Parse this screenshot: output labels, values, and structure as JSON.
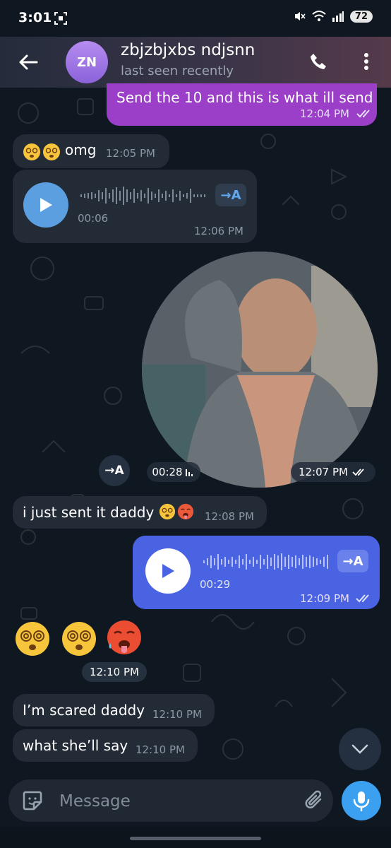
{
  "status_bar": {
    "time": "3:01",
    "battery": "72"
  },
  "header": {
    "avatar_initials": "ZN",
    "contact_name": "zbjzbjxbs ndjsnn",
    "contact_status": "last seen recently",
    "accent_color": "#8b62d9"
  },
  "messages": [
    {
      "type": "text",
      "direction": "out",
      "text": "Send the 10 and this is what ill send",
      "time": "12:04 PM",
      "read": true
    },
    {
      "type": "text",
      "direction": "in",
      "emoji": [
        "dizzy-face",
        "dizzy-face"
      ],
      "text": "omg",
      "time": "12:05 PM"
    },
    {
      "type": "voice",
      "direction": "in",
      "duration": "00:06",
      "time": "12:06 PM",
      "transcribe_label": "→A"
    },
    {
      "type": "video",
      "direction": "out",
      "duration": "00:28",
      "time": "12:07 PM",
      "read": true,
      "transcribe_label": "→A"
    },
    {
      "type": "text",
      "direction": "in",
      "text": "i just sent it daddy",
      "emoji": [
        "dizzy-face",
        "hot-face"
      ],
      "time": "12:08 PM"
    },
    {
      "type": "voice",
      "direction": "out",
      "duration": "00:29",
      "time": "12:09 PM",
      "read": true,
      "transcribe_label": "→A"
    },
    {
      "type": "emoji",
      "direction": "in",
      "emoji": [
        "dizzy-face",
        "dizzy-face",
        "hot-face"
      ],
      "time": "12:10 PM"
    },
    {
      "type": "text",
      "direction": "in",
      "text": "I’m scared daddy",
      "time": "12:10 PM"
    },
    {
      "type": "text",
      "direction": "in",
      "text": "what she’ll say",
      "time": "12:10 PM"
    }
  ],
  "input": {
    "placeholder": "Message"
  },
  "colors": {
    "background": "#0f1821",
    "incoming_bubble": "#222b36",
    "outgoing_purple": "#9b3ec8",
    "outgoing_blue": "#4a63e3",
    "accent": "#3ba0f0"
  }
}
